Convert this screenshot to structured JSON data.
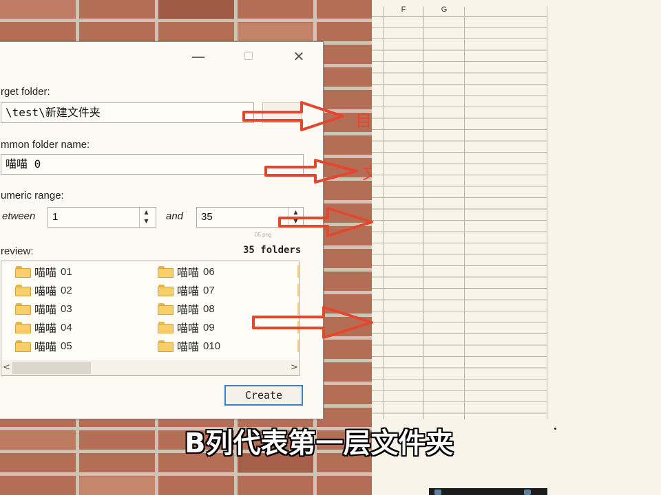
{
  "dialog": {
    "window_controls": {
      "minimize": "—",
      "maximize": "☐",
      "close": "✕"
    },
    "target_folder": {
      "label": "rget folder:",
      "value": "\\test\\新建文件夹"
    },
    "common_folder_name": {
      "label": "mmon folder name:",
      "value": "喵喵 0"
    },
    "numeric_range": {
      "label": "umeric range:",
      "between_label": "etween",
      "from_value": "1",
      "and_label": "and",
      "to_value": "35",
      "hint": "05.png"
    },
    "preview": {
      "label": "review:",
      "count_label": "35 folders",
      "items": [
        {
          "name": "喵喵",
          "num": "01"
        },
        {
          "name": "喵喵",
          "num": "02"
        },
        {
          "name": "喵喵",
          "num": "03"
        },
        {
          "name": "喵喵",
          "num": "04"
        },
        {
          "name": "喵喵",
          "num": "05"
        },
        {
          "name": "喵喵",
          "num": "06"
        },
        {
          "name": "喵喵",
          "num": "07"
        },
        {
          "name": "喵喵",
          "num": "08"
        },
        {
          "name": "喵喵",
          "num": "09"
        },
        {
          "name": "喵喵",
          "num": "010"
        }
      ],
      "scroll_left": "<",
      "scroll_right": ">"
    },
    "create_button": "Create"
  },
  "spreadsheet": {
    "columns": [
      "F",
      "G"
    ]
  },
  "annotations": [
    "目",
    "文"
  ],
  "subtitle": "B列代表第一层文件夹",
  "colors": {
    "arrow_red": "#e3482f",
    "create_button_border": "#3c7fc9",
    "folder_yellow": "#f6cf6b",
    "sheet_background": "#f9f4e9"
  },
  "icons": [
    "folder-icon",
    "spin-up-icon",
    "spin-down-icon",
    "close-icon",
    "minimize-icon",
    "maximize-icon",
    "arrow-right-icon"
  ]
}
